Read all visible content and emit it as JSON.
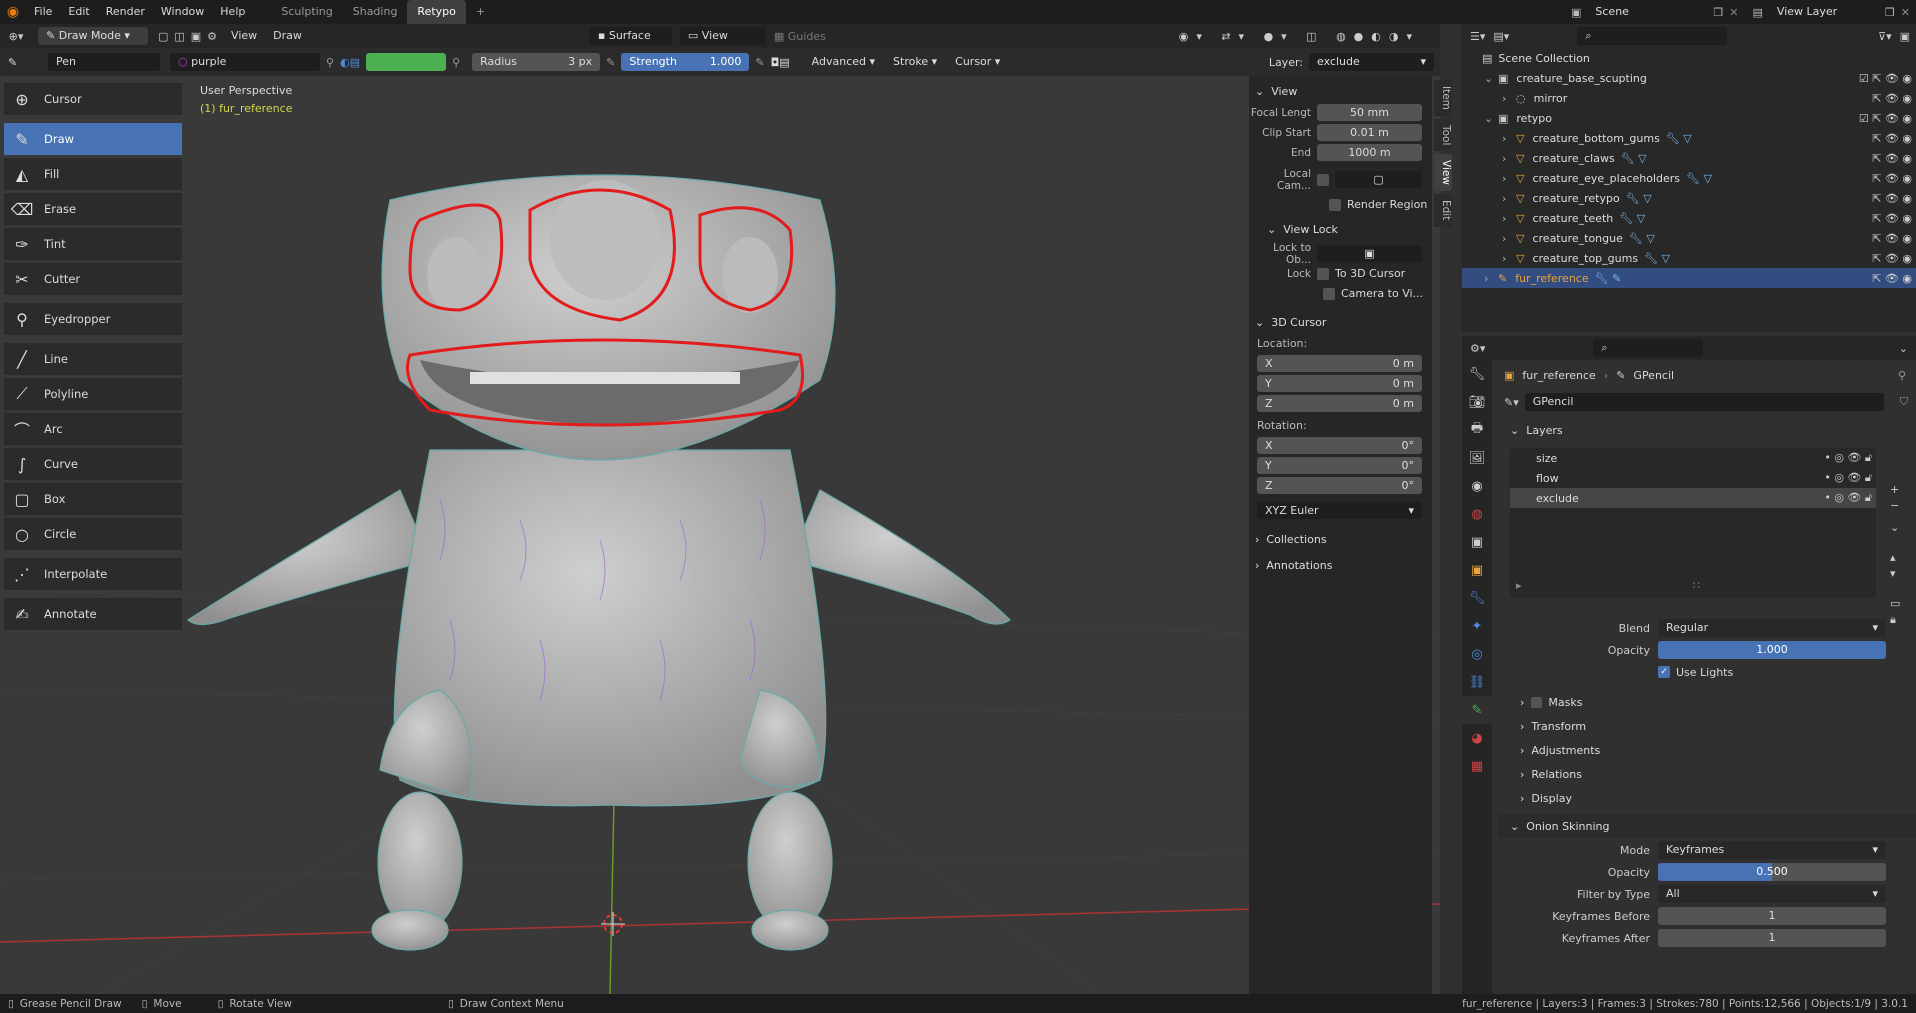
{
  "topbar": {
    "menus": [
      "File",
      "Edit",
      "Render",
      "Window",
      "Help"
    ],
    "workspaces": [
      "Sculpting",
      "Shading",
      "Retypo"
    ],
    "active_workspace": "Retypo",
    "add_tab": "+",
    "scene_label": "Scene",
    "view_layer_label": "View Layer"
  },
  "header3d": {
    "mode": "Draw Mode",
    "menus": [
      "View",
      "Draw"
    ],
    "surface": "Surface",
    "view": "View",
    "guides": "Guides"
  },
  "toolhdr": {
    "brush": "Pen",
    "material": "purple",
    "radius_label": "Radius",
    "radius_value": "3 px",
    "strength_label": "Strength",
    "strength_value": "1.000",
    "advanced": "Advanced",
    "stroke": "Stroke",
    "cursor": "Cursor",
    "layer_label": "Layer:",
    "layer_value": "exclude",
    "color_hex": "#4caf50"
  },
  "viewport": {
    "perspective": "User Perspective",
    "object": "(1) fur_reference"
  },
  "tools": [
    {
      "label": "Cursor",
      "icon": "cursor-icon"
    },
    {
      "label": "Draw",
      "icon": "draw-icon",
      "selected": true
    },
    {
      "label": "Fill",
      "icon": "fill-icon"
    },
    {
      "label": "Erase",
      "icon": "erase-icon"
    },
    {
      "label": "Tint",
      "icon": "tint-icon"
    },
    {
      "label": "Cutter",
      "icon": "cutter-icon"
    },
    {
      "label": "Eyedropper",
      "icon": "eyedropper-icon"
    },
    {
      "label": "Line",
      "icon": "line-icon"
    },
    {
      "label": "Polyline",
      "icon": "polyline-icon"
    },
    {
      "label": "Arc",
      "icon": "arc-icon"
    },
    {
      "label": "Curve",
      "icon": "curve-icon"
    },
    {
      "label": "Box",
      "icon": "box-icon"
    },
    {
      "label": "Circle",
      "icon": "circle-icon"
    },
    {
      "label": "Interpolate",
      "icon": "interpolate-icon"
    },
    {
      "label": "Annotate",
      "icon": "annotate-icon"
    }
  ],
  "npanel": {
    "view_section": "View",
    "focal_label": "Focal Lengt",
    "focal_value": "50 mm",
    "clip_start_label": "Clip Start",
    "clip_start_value": "0.01 m",
    "end_label": "End",
    "end_value": "1000 m",
    "local_cam_label": "Local Cam...",
    "render_region": "Render Region",
    "view_lock": "View Lock",
    "lock_to_obj_label": "Lock to Ob...",
    "lock_label": "Lock",
    "to_3d_cursor": "To 3D Cursor",
    "camera_to_view": "Camera to Vi...",
    "cursor_section": "3D Cursor",
    "location_label": "Location:",
    "loc_x": "0 m",
    "loc_y": "0 m",
    "loc_z": "0 m",
    "rotation_label": "Rotation:",
    "rot_x": "0°",
    "rot_y": "0°",
    "rot_z": "0°",
    "rot_mode": "XYZ Euler",
    "collections": "Collections",
    "annotations": "Annotations",
    "x": "X",
    "y": "Y",
    "z": "Z",
    "tabs": [
      "Item",
      "Tool",
      "View",
      "Edit"
    ]
  },
  "outliner": {
    "root": "Scene Collection",
    "items": [
      {
        "label": "creature_base_scupting",
        "level": 1,
        "type": "collection"
      },
      {
        "label": "mirror",
        "level": 2,
        "type": "object"
      },
      {
        "label": "retypo",
        "level": 1,
        "type": "collection"
      },
      {
        "label": "creature_bottom_gums",
        "level": 2,
        "type": "mesh"
      },
      {
        "label": "creature_claws",
        "level": 2,
        "type": "mesh"
      },
      {
        "label": "creature_eye_placeholders",
        "level": 2,
        "type": "mesh"
      },
      {
        "label": "creature_retypo",
        "level": 2,
        "type": "mesh"
      },
      {
        "label": "creature_teeth",
        "level": 2,
        "type": "mesh"
      },
      {
        "label": "creature_tongue",
        "level": 2,
        "type": "mesh"
      },
      {
        "label": "creature_top_gums",
        "level": 2,
        "type": "mesh"
      },
      {
        "label": "fur_reference",
        "level": 1,
        "type": "gpencil",
        "selected": true
      }
    ]
  },
  "props": {
    "breadcrumb_obj": "fur_reference",
    "breadcrumb_data": "GPencil",
    "data_name": "GPencil",
    "layers_section": "Layers",
    "layers": [
      "size",
      "flow",
      "exclude"
    ],
    "active_layer": "exclude",
    "blend_label": "Blend",
    "blend_value": "Regular",
    "opacity_label": "Opacity",
    "opacity_value": "1.000",
    "use_lights": "Use Lights",
    "masks": "Masks",
    "transform": "Transform",
    "adjustments": "Adjustments",
    "relations": "Relations",
    "display": "Display",
    "onion_section": "Onion Skinning",
    "mode_label": "Mode",
    "mode_value": "Keyframes",
    "onion_opacity_label": "Opacity",
    "onion_opacity_value": "0.500",
    "filter_label": "Filter by Type",
    "filter_value": "All",
    "kf_before_label": "Keyframes Before",
    "kf_before_value": "1",
    "kf_after_label": "Keyframes After",
    "kf_after_value": "1"
  },
  "statusbar": {
    "item1": "Grease Pencil Draw",
    "item2": "Move",
    "item3": "Rotate View",
    "item4": "Draw Context Menu",
    "stats": "fur_reference | Layers:3 | Frames:3 | Strokes:780 | Points:12,566 | Objects:1/9 | 3.0.1"
  }
}
